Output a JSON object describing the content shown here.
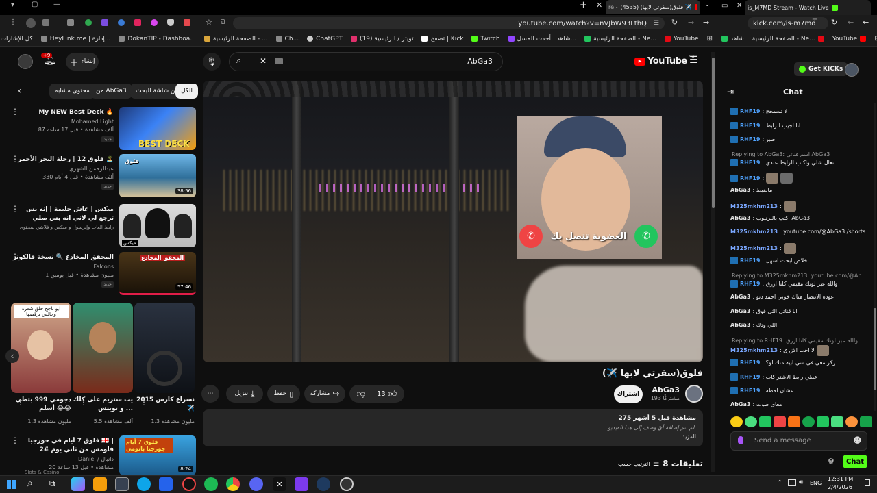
{
  "left_window": {
    "tabs": [
      {
        "title": "فلوق(سفرتي لابها) (4535) ✈️"
      },
      {
        "title": "re -"
      }
    ],
    "address": {
      "url": "youtube.com/watch?v=nVJbW93LthQ"
    },
    "bookmarks": [
      {
        "label": "كل الإشارات المرجعية",
        "color": "#e3b341"
      },
      {
        "label": "HeyLink.me | إدارة...",
        "color": "#8a8a8a"
      },
      {
        "label": "DokanTIP - Dashboa...",
        "color": "#8a8a8a"
      },
      {
        "label": "الصفحة الرئيسية - ...",
        "color": "#d9a53b"
      },
      {
        "label": "Ch...",
        "color": "#8a8a8a"
      },
      {
        "label": "ChatGPT",
        "color": "#cccccc"
      },
      {
        "label": "(19) تويتر / الرئيسية",
        "color": "#e1306c"
      },
      {
        "label": "تصفح | Kick",
        "color": "#ffffff"
      },
      {
        "label": "Twitch",
        "color": "#53fc18"
      },
      {
        "label": "شاهد | أحدث المسل...",
        "color": "#9146ff"
      },
      {
        "label": "الصفحة الرئيسية - Ne...",
        "color": "#22c55e"
      },
      {
        "label": "YouTube",
        "color": "#e50914"
      }
    ]
  },
  "right_window": {
    "tabs": [
      {
        "title": "is_M7MD Stream - Watch Live"
      }
    ],
    "address": {
      "url": "kick.com/is-m7md"
    },
    "bookmarks": [
      {
        "label": "شاهد",
        "color": "#22c55e"
      },
      {
        "label": "الصفحة الرئيسية - Ne...",
        "color": "#e50914"
      },
      {
        "label": "YouTube",
        "color": "#ff0000"
      }
    ]
  },
  "youtube": {
    "logo_text": "YouTube",
    "region": "SA",
    "search": {
      "value": "AbGa3"
    },
    "create_label": "إنشاء",
    "notifications_badge": "+9",
    "chips": [
      "الكل",
      "من شاشة البحث",
      "من AbGa3",
      "محتوى مشابه"
    ],
    "video": {
      "title": "فلوق(سفرتي لابها ✈️)",
      "overlay_caption": "العضوية تتصل بك",
      "channel": "AbGa3",
      "subscribers": "193 مشتركًا",
      "subscribe_label": "اشتراك",
      "likes": "13",
      "share_label": "مشاركة",
      "save_label": "حفظ",
      "download_label": "تنزيل",
      "description": {
        "views": "275 مشاهدة قبل 5 أشهر",
        "text": "لم تتم إضافة أيّ وصف إلى هذا الفيديو.",
        "more": "...المزيد"
      },
      "comments_title": "8 تعليقات",
      "sort_label": "الترتيب حسب"
    },
    "related": [
      {
        "title": "My NEW Best Deck 🔥",
        "channel": "Mohamed Light",
        "meta": "87 ألف مشاهدة • قبل 17 ساعة",
        "badge": "جديد",
        "thumb_text": "BEST DECK",
        "duration": "",
        "bg": "#1e3a7a"
      },
      {
        "title": "فلوق 12 | رحلة البحر الأحمر 🏝️",
        "channel": "عبدالرحمن الشهري",
        "meta": "330 ألف مشاهدة • قبل 4 أيام",
        "badge": "جديد",
        "thumb_text": "فلوق",
        "duration": "38:56",
        "bg": "#2f6f9a"
      },
      {
        "title": "ميكس | عاش حليمة | إنه بس ترجع لي لاني انه بس صلي الخروج - استكمال",
        "channel": "رابط العاب وإيرسول و ميكس و فلاشن لمحتوى",
        "meta": "",
        "badge": "",
        "thumb_text": "ميكس",
        "duration": "",
        "bg": "#1a1a1a"
      },
      {
        "title": "المحقق المخادع 🔍 نسخة فالكونز",
        "channel": "Falcons",
        "meta": "1 مليون مشاهدة • قبل يومين",
        "badge": "جديد",
        "thumb_text": "المحقق المخادع",
        "duration": "57:46",
        "bg": "#3a2a10"
      }
    ],
    "shorts": [
      {
        "title": "نسراع كارس 2015 ✈️",
        "views": "1.3 مليون مشاهدة",
        "bg": "#223"
      },
      {
        "title": "يت ستريم على كلك و تويتش ...",
        "views": "5.5 آلف مشاهدة",
        "bg": "#35201a"
      },
      {
        "title": "دجومي 999 بتطي أسلم 😂😂",
        "views": "1.3 مليون مشاهدة",
        "bg": "#4a2a2a",
        "overlay": "ابو ناجح حلق شعره وجالس برقصها"
      }
    ],
    "bottom_item": {
      "title": "فلوق 7 أيام في جورجيا 🇬🇪 | فلومس من ثاني يوم #2",
      "channel": "Daniel / دانيال",
      "meta": "20 مشاهدة • قبل 13 ساعة",
      "thumb_text": "فلوق 7 أيام جورجيا باتومي",
      "duration": "8:24",
      "cut": "Slots & Casino"
    }
  },
  "kick": {
    "get_kicks": "Get KICKs",
    "chat_title": "Chat",
    "send_placeholder": "Send a message",
    "chat_button": "Chat",
    "messages": [
      {
        "user": "RHF19",
        "text": ": لا تسمحج",
        "type": "rhf"
      },
      {
        "user": "RHF19",
        "text": ": انا اجيب الرابط",
        "type": "rhf"
      },
      {
        "user": "RHF19",
        "text": ": اصبر",
        "type": "rhf"
      },
      {
        "reply": "Replying to AbGa3: اسم قناتي AbGa3"
      },
      {
        "user": "RHF19",
        "text": ": تعال شلي واكتب الرابط عندي",
        "type": "rhf"
      },
      {
        "user": "RHF19",
        "text": ":",
        "type": "rhf",
        "emotes": 2
      },
      {
        "user": "AbGa3",
        "text": ": ماضبط",
        "type": "abg"
      },
      {
        "user": "M325mkhm213",
        "text": ":",
        "type": "m3",
        "emotes": 1
      },
      {
        "user": "AbGa3",
        "text": ": اكتب بالبرنيوب AbGa3",
        "type": "abg"
      },
      {
        "user": "M325mkhm213",
        "text": ": youtube.com/@AbGa3./shorts",
        "type": "m3"
      },
      {
        "user": "M325mkhm213",
        "text": ":",
        "type": "m3",
        "emotes": 1
      },
      {
        "user": "RHF19",
        "text": ": خلاص ابحث اسهل",
        "type": "rhf"
      },
      {
        "reply": "Replying to M325mkhm213: youtube.com/@Ab..."
      },
      {
        "user": "RHF19",
        "text": ": والله عبر لونك مقيمي كلنا ازرق",
        "type": "rhf"
      },
      {
        "user": "AbGa3",
        "text": ": عوده الانتصار هناك خوبي احمد دنو",
        "type": "abg"
      },
      {
        "user": "AbGa3",
        "text": ": انا قناتي الثي فوق",
        "type": "abg"
      },
      {
        "user": "AbGa3",
        "text": ": اللي ودك",
        "type": "abg"
      },
      {
        "reply": "Replying to RHF19: والله عبر لونك مقيمي كلنا ازرق"
      },
      {
        "user": "M325mkhm213",
        "text": ": لا احب الازرق",
        "type": "m3",
        "emotes": 1
      },
      {
        "user": "RHF19",
        "text": ": ركز معي في شي ابيه منك لو؟",
        "type": "rhf"
      },
      {
        "user": "RHF19",
        "text": ": عطي رابط الاشتراكات",
        "type": "rhf"
      },
      {
        "user": "RHF19",
        "text": ": عشان احطه",
        "type": "rhf"
      },
      {
        "user": "AbGa3",
        "text": ": معاي صوت",
        "type": "abg"
      }
    ]
  },
  "taskbar": {
    "lang": "ENG",
    "time": "12:31 PM",
    "date": "2/4/2026"
  }
}
